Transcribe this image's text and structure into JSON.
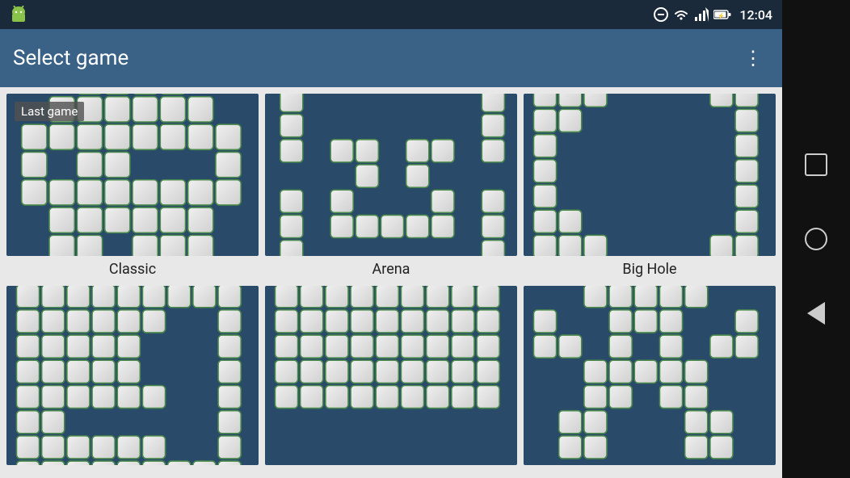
{
  "statusBar": {
    "time": "12:04",
    "icons": [
      "minus-circle",
      "wifi",
      "signal",
      "battery"
    ]
  },
  "appBar": {
    "title": "Select game",
    "moreOptionsLabel": "⋮"
  },
  "games": [
    {
      "id": "classic",
      "label": "Classic",
      "lastGame": true,
      "lastGameBadge": "Last game",
      "type": "classic"
    },
    {
      "id": "arena",
      "label": "Arena",
      "lastGame": false,
      "type": "arena"
    },
    {
      "id": "big-hole",
      "label": "Big Hole",
      "lastGame": false,
      "type": "bighole"
    },
    {
      "id": "spiral",
      "label": "",
      "lastGame": false,
      "type": "spiral"
    },
    {
      "id": "flat",
      "label": "",
      "lastGame": false,
      "type": "flat"
    },
    {
      "id": "figure",
      "label": "",
      "lastGame": false,
      "type": "figure"
    }
  ],
  "navBar": {
    "buttons": [
      "square",
      "circle",
      "back"
    ]
  }
}
